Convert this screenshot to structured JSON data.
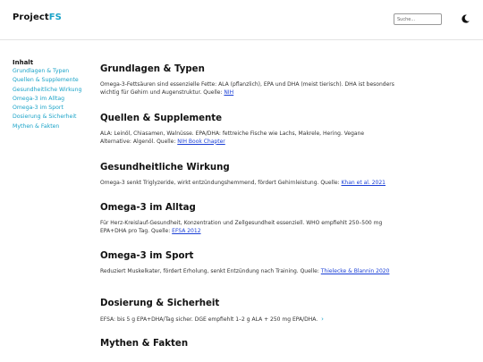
{
  "header": {
    "logo_main": "Project",
    "logo_accent": "FS",
    "search_placeholder": "Suche..."
  },
  "sidebar": {
    "title": "Inhalt",
    "items": [
      "Grundlagen & Typen",
      "Quellen & Supplemente",
      "Gesundheitliche Wirkung",
      "Omega-3 im Alltag",
      "Omega-3 im Sport",
      "Dosierung & Sicherheit",
      "Mythen & Fakten"
    ]
  },
  "sections": [
    {
      "title": "Grundlagen & Typen",
      "text": "Omega-3-Fettsäuren sind essenzielle Fette: ALA (pflanzlich), EPA und DHA (meist tierisch). DHA ist besonders wichtig für Gehirn und Augenstruktur. Quelle: ",
      "link": "NIH"
    },
    {
      "title": "Quellen & Supplemente",
      "text": "ALA: Leinöl, Chiasamen, Walnüsse. EPA/DHA: fettreiche Fische wie Lachs, Makrele, Hering. Vegane Alternative: Algenöl. Quelle: ",
      "link": "NIH Book Chapter"
    },
    {
      "title": "Gesundheitliche Wirkung",
      "text": "Omega-3 senkt Triglyzeride, wirkt entzündungshemmend, fördert Gehirnleistung. Quelle: ",
      "link": "Khan et al. 2021"
    },
    {
      "title": "Omega-3 im Alltag",
      "text": "Für Herz-Kreislauf-Gesundheit, Konzentration und Zellgesundheit essenziell. WHO empfiehlt 250–500 mg EPA+DHA pro Tag. Quelle: ",
      "link": "EFSA 2012"
    },
    {
      "title": "Omega-3 im Sport",
      "text": "Reduziert Muskelkater, fördert Erholung, senkt Entzündung nach Training. Quelle: ",
      "link": "Thielecke & Blannin 2020"
    },
    {
      "title": "Dosierung & Sicherheit",
      "text": "EFSA: bis 5 g EPA+DHA/Tag sicher. DGE empfiehlt 1–2 g ALA + 250 mg EPA/DHA."
    },
    {
      "title": "Mythen & Fakten"
    }
  ]
}
